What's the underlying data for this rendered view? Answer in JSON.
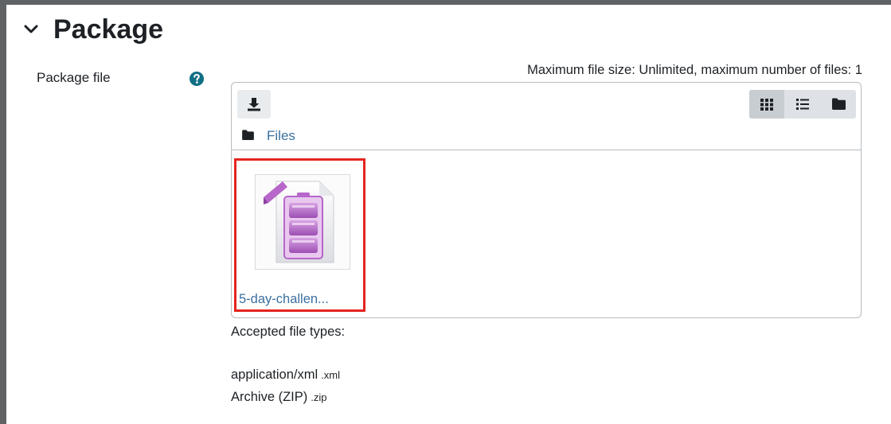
{
  "section": {
    "title": "Package",
    "toggle_icon": "chevron-down-icon"
  },
  "field": {
    "label": "Package file",
    "help_icon": "question-circle-icon"
  },
  "limits": {
    "text": "Maximum file size: Unlimited, maximum number of files: 1"
  },
  "filemanager": {
    "add_icon": "download-icon",
    "view_icons": [
      "grid-icon",
      "list-icon",
      "folder-icon"
    ],
    "active_view": "grid-icon",
    "path": {
      "label": "Files",
      "icon": "folder-icon"
    },
    "files": [
      {
        "name": "5-day-challen...",
        "icon": "zip-archive-icon"
      }
    ]
  },
  "accepted": {
    "title": "Accepted file types:",
    "types": [
      {
        "name": "application/xml",
        "ext": ".xml"
      },
      {
        "name": "Archive (ZIP)",
        "ext": ".zip"
      }
    ]
  },
  "colors": {
    "link": "#3a6fa0",
    "help": "#0f6e84",
    "highlight": "#e5241f",
    "archive": "#b667c9"
  }
}
